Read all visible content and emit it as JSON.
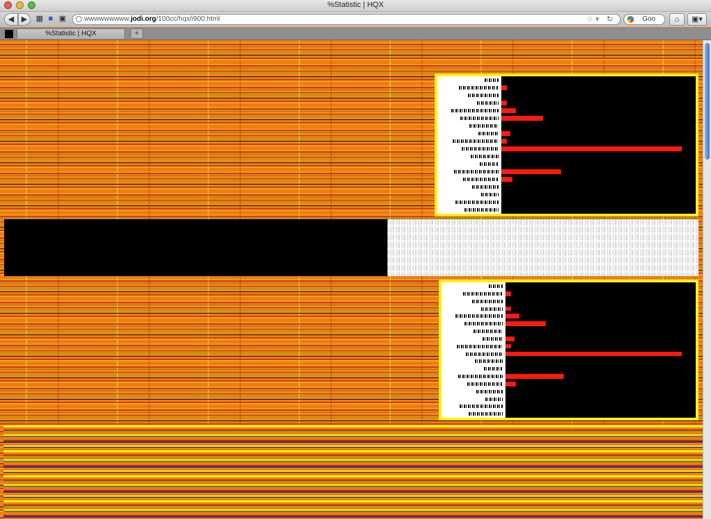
{
  "window": {
    "title": "%Statistic | HQX"
  },
  "toolbar": {
    "url_prefix": "wwwwwwwww.",
    "url_domain": "jodi.org",
    "url_path": "/100cc/hqx/i900.html",
    "search_text": "Goo"
  },
  "tabs": [
    {
      "label": "%Statistic | HQX",
      "active": true
    }
  ],
  "colors": {
    "background_orange": "#e8800c",
    "stripe_red": "#d7261a",
    "panel_border_yellow": "#f5f11a",
    "bar_red": "#ff1a0a"
  },
  "icons": [
    "back-icon",
    "forward-icon",
    "bookmark-icon",
    "save-icon",
    "lock-icon",
    "globe-icon",
    "star-icon",
    "reload-icon",
    "google-icon",
    "home-icon",
    "bookmark-menu-icon"
  ],
  "panels": [
    {
      "bars": [
        0.03,
        0.03,
        0.08,
        0.23,
        0.05,
        0.03,
        1.0,
        0.33,
        0.06
      ]
    },
    {
      "bars": [
        0.03,
        0.03,
        0.08,
        0.23,
        0.05,
        0.03,
        1.0,
        0.33,
        0.06
      ]
    }
  ]
}
